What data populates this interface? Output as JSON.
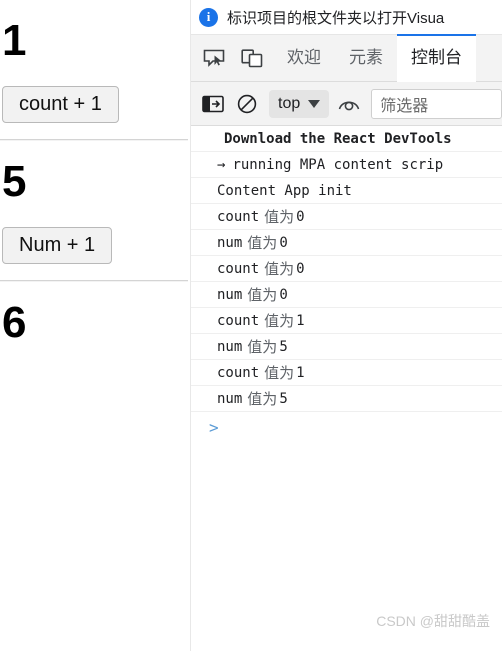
{
  "page": {
    "count_heading": "1",
    "count_button": "count + 1",
    "num_heading": "5",
    "num_button": "Num + 1",
    "third_heading": "6"
  },
  "devtools": {
    "infobar": {
      "icon": "info-icon",
      "text": "标识项目的根文件夹以打开Visua"
    },
    "tabstrip": {
      "inspect_icon": "inspect-element-icon",
      "device_icon": "device-toolbar-icon",
      "tabs": [
        {
          "label": "欢迎",
          "active": false
        },
        {
          "label": "元素",
          "active": false
        },
        {
          "label": "控制台",
          "active": true
        }
      ]
    },
    "console_toolbar": {
      "sidebar_icon": "console-sidebar-icon",
      "clear_icon": "clear-console-icon",
      "context": "top",
      "eye_icon": "live-expression-eye-icon",
      "filter_placeholder": "筛选器"
    },
    "console_rows": [
      {
        "prefix": "",
        "text": "Download the React DevTools",
        "bold": true,
        "label": "",
        "value": ""
      },
      {
        "prefix": "→",
        "text": "running MPA content scrip",
        "bold": false,
        "label": "",
        "value": ""
      },
      {
        "prefix": "",
        "text": "Content App init",
        "bold": false,
        "label": "",
        "value": ""
      },
      {
        "prefix": "",
        "text": "count",
        "bold": false,
        "label": "值为",
        "value": "0"
      },
      {
        "prefix": "",
        "text": "num",
        "bold": false,
        "label": "值为",
        "value": " 0"
      },
      {
        "prefix": "",
        "text": "count",
        "bold": false,
        "label": "值为",
        "value": "0"
      },
      {
        "prefix": "",
        "text": "num",
        "bold": false,
        "label": "值为",
        "value": " 0"
      },
      {
        "prefix": "",
        "text": "count",
        "bold": false,
        "label": "值为",
        "value": "1"
      },
      {
        "prefix": "",
        "text": "num",
        "bold": false,
        "label": "值为",
        "value": " 5"
      },
      {
        "prefix": "",
        "text": "count",
        "bold": false,
        "label": "值为",
        "value": "1"
      },
      {
        "prefix": "",
        "text": "num",
        "bold": false,
        "label": "值为",
        "value": " 5"
      }
    ],
    "prompt_symbol": ">"
  },
  "watermark": "CSDN @甜甜酷盖",
  "colors": {
    "accent": "#1a73e8",
    "prompt": "#5b9bd5",
    "text": "#202124",
    "muted": "#5f6368"
  }
}
